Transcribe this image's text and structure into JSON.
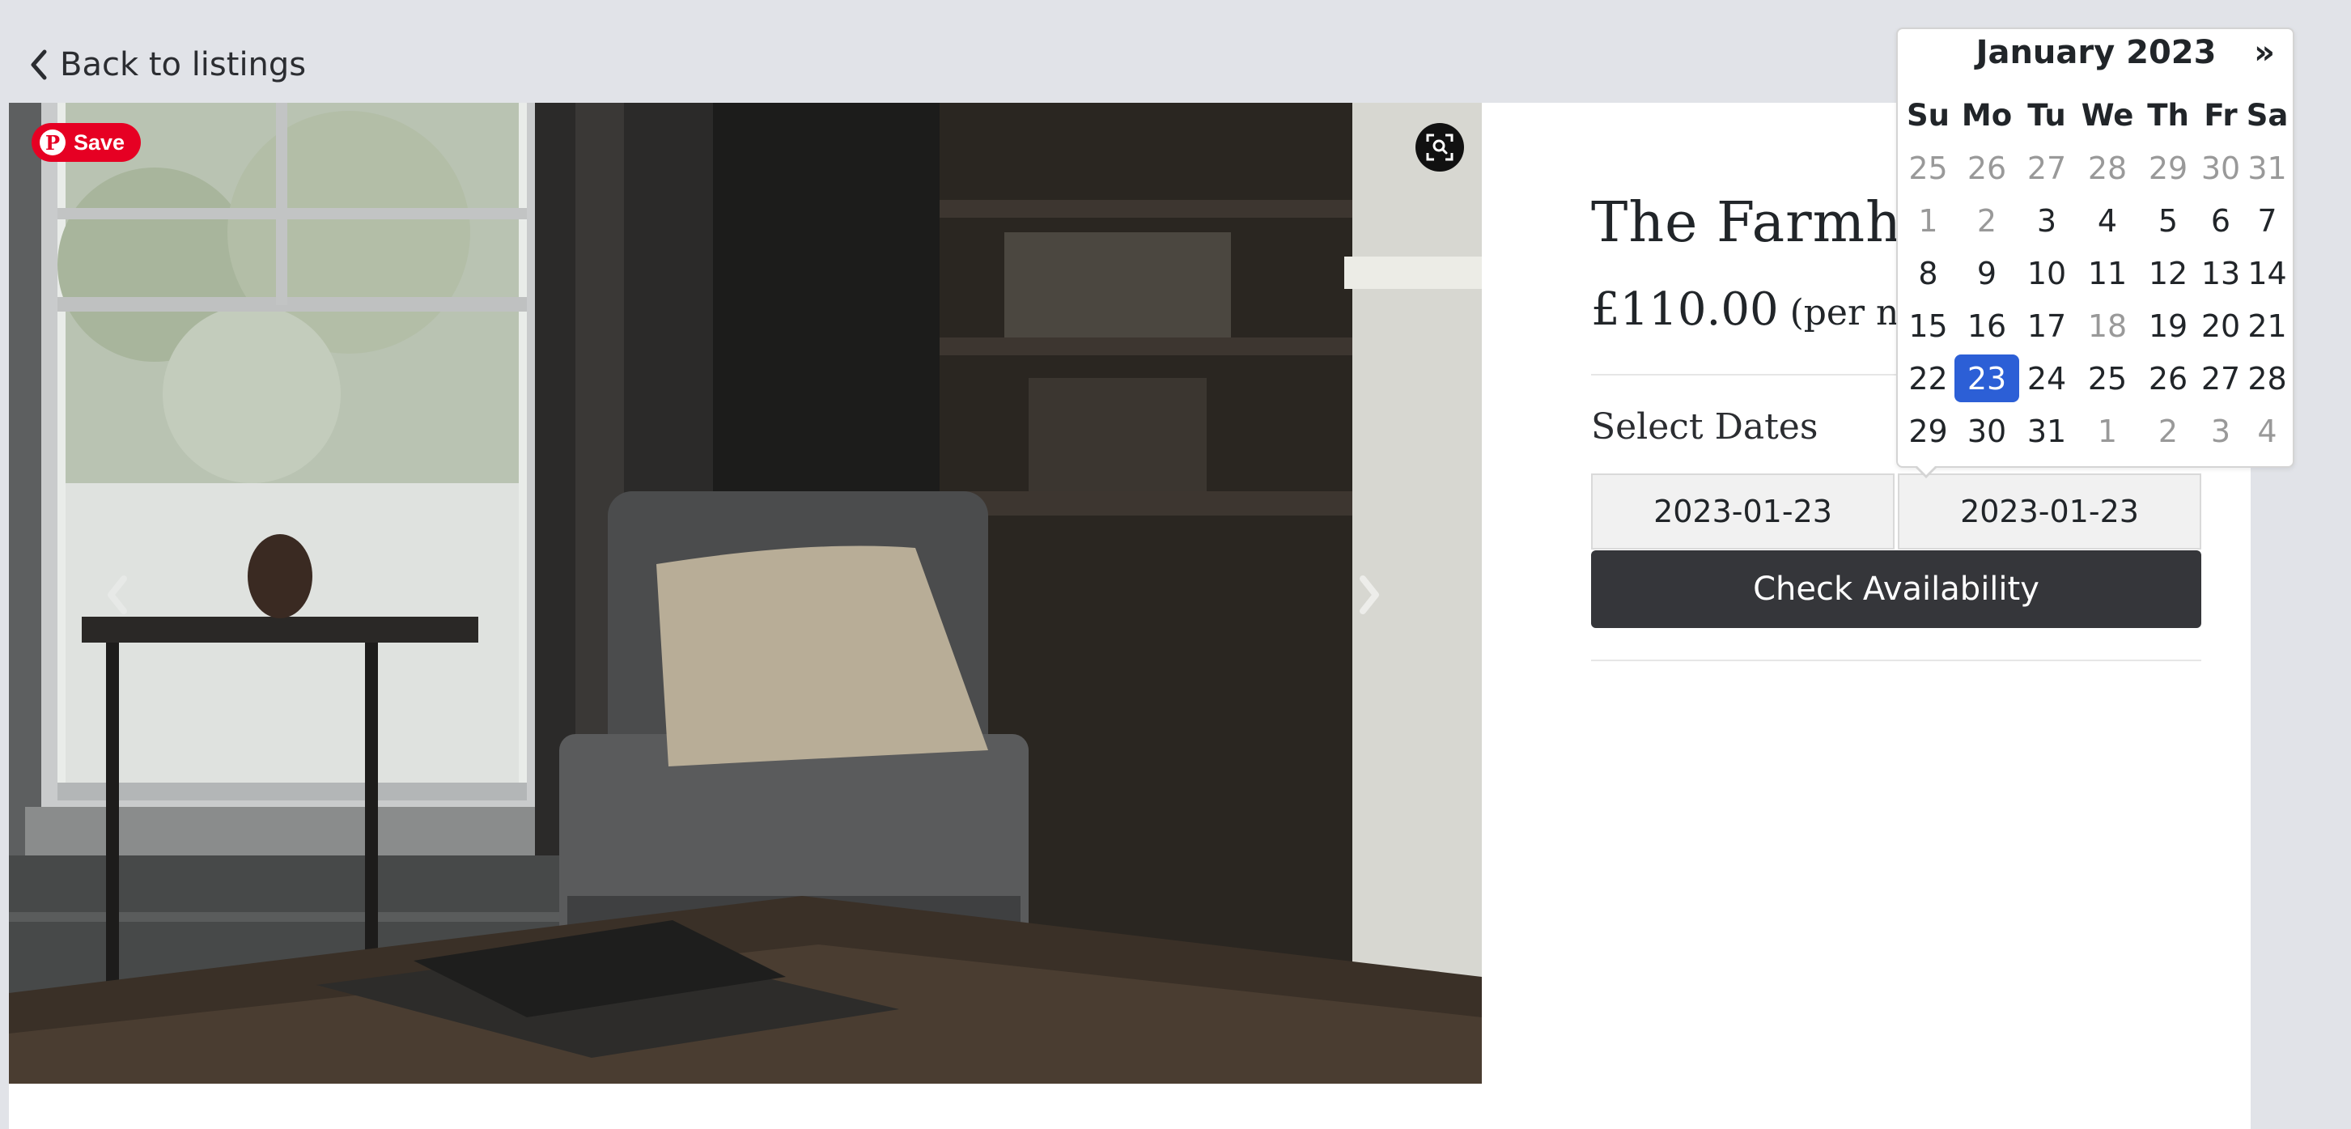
{
  "nav": {
    "back_label": "Back to listings"
  },
  "listing": {
    "title": "The Farmhou",
    "price": "£110.00",
    "price_suffix": "(per nig",
    "select_dates_label": "Select Dates",
    "start_date": "2023-01-23",
    "end_date": "2023-01-23",
    "check_button": "Check Availability"
  },
  "photo": {
    "save_label": "Save"
  },
  "calendar": {
    "month_label": "January 2023",
    "next_label": "»",
    "weekdays": [
      "Su",
      "Mo",
      "Tu",
      "We",
      "Th",
      "Fr",
      "Sa"
    ],
    "weeks": [
      [
        {
          "d": "25",
          "m": 1
        },
        {
          "d": "26",
          "m": 1
        },
        {
          "d": "27",
          "m": 1
        },
        {
          "d": "28",
          "m": 1
        },
        {
          "d": "29",
          "m": 1
        },
        {
          "d": "30",
          "m": 1
        },
        {
          "d": "31",
          "m": 1
        }
      ],
      [
        {
          "d": "1",
          "m": 1
        },
        {
          "d": "2",
          "m": 1
        },
        {
          "d": "3",
          "m": 0
        },
        {
          "d": "4",
          "m": 0
        },
        {
          "d": "5",
          "m": 0
        },
        {
          "d": "6",
          "m": 0
        },
        {
          "d": "7",
          "m": 0
        }
      ],
      [
        {
          "d": "8",
          "m": 0
        },
        {
          "d": "9",
          "m": 0
        },
        {
          "d": "10",
          "m": 0
        },
        {
          "d": "11",
          "m": 0
        },
        {
          "d": "12",
          "m": 0
        },
        {
          "d": "13",
          "m": 0
        },
        {
          "d": "14",
          "m": 0
        }
      ],
      [
        {
          "d": "15",
          "m": 0
        },
        {
          "d": "16",
          "m": 0
        },
        {
          "d": "17",
          "m": 0
        },
        {
          "d": "18",
          "m": 1
        },
        {
          "d": "19",
          "m": 0
        },
        {
          "d": "20",
          "m": 0
        },
        {
          "d": "21",
          "m": 0
        }
      ],
      [
        {
          "d": "22",
          "m": 0
        },
        {
          "d": "23",
          "m": 0,
          "sel": 1
        },
        {
          "d": "24",
          "m": 0
        },
        {
          "d": "25",
          "m": 0
        },
        {
          "d": "26",
          "m": 0
        },
        {
          "d": "27",
          "m": 0
        },
        {
          "d": "28",
          "m": 0
        }
      ],
      [
        {
          "d": "29",
          "m": 0
        },
        {
          "d": "30",
          "m": 0
        },
        {
          "d": "31",
          "m": 0
        },
        {
          "d": "1",
          "m": 1
        },
        {
          "d": "2",
          "m": 1
        },
        {
          "d": "3",
          "m": 1
        },
        {
          "d": "4",
          "m": 1
        }
      ]
    ]
  },
  "colors": {
    "background": "#e1e3e8",
    "button_dark": "#35363a",
    "selected_day": "#2c5fd6",
    "pinterest": "#e60023"
  }
}
